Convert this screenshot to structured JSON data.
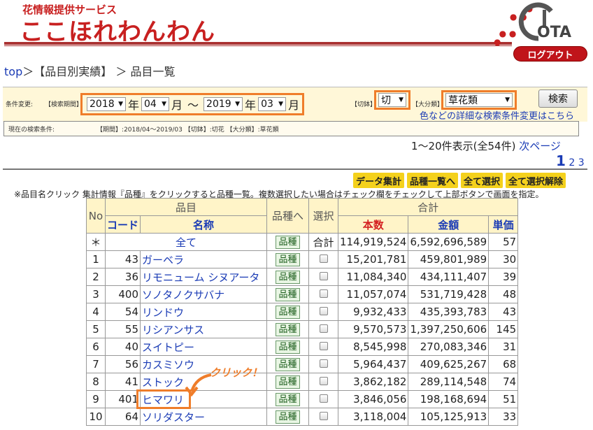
{
  "header": {
    "site_sub": "花情報提供サービス",
    "site_title": "ここほれわんわん",
    "logo_text": "OTA",
    "logout_label": "ログアウト"
  },
  "breadcrumb": {
    "top": "top",
    "sep1": "＞",
    "section": "【品目別実績】",
    "sep2": " ＞ ",
    "current": "品目一覧"
  },
  "conditions": {
    "label_change": "条件変更:",
    "label_period": "【検索期間】",
    "from_year": "2018",
    "from_month": "04",
    "to_year": "2019",
    "to_month": "03",
    "year_unit": "年",
    "month_unit": "月",
    "tilde": "〜",
    "label_kiri": "【切鉢】",
    "kiri_value": "切",
    "label_dai": "【大分類】",
    "dai_value": "草花類",
    "search_label": "検索",
    "detail_link": "色などの詳細な検索条件変更はこちら"
  },
  "current": {
    "label": "現在の検索条件:",
    "value": "【期間】:2018/04〜2019/03 【切鉢】:切花 【大分類】:草花類"
  },
  "pagination": {
    "range": "1〜20件表示(全54件)",
    "next": "次ページ",
    "current": "1",
    "p2": "2",
    "p3": "3"
  },
  "actions": [
    "データ集計",
    "品種一覧へ",
    "全て選択",
    "全て選択解除"
  ],
  "note": "※品目名クリック 集計情報『品種』をクリックすると品種一覧。複数選択したい場合はチェック欄をチェックして上部ボタンで画面を指定。",
  "table": {
    "h_no": "No",
    "h_item": "品目",
    "h_kind": "品種へ",
    "h_sel": "選択",
    "h_total": "合計",
    "h_code": "コード",
    "h_name": "名称",
    "h_num": "本数",
    "h_amt": "金額",
    "h_unit": "単価",
    "total_row": {
      "no": "＊",
      "name": "全て",
      "kind": "品種",
      "sel": "合計",
      "num": "114,919,524",
      "amt": "6,592,696,589",
      "unit": "57"
    },
    "kind_label": "品種",
    "rows": [
      {
        "no": "1",
        "code": "43",
        "name": "ガーベラ",
        "num": "15,201,781",
        "amt": "459,801,989",
        "unit": "30"
      },
      {
        "no": "2",
        "code": "36",
        "name": "リモニューム シヌアータ",
        "num": "11,084,340",
        "amt": "434,111,407",
        "unit": "39"
      },
      {
        "no": "3",
        "code": "400",
        "name": "ソノタノクサバナ",
        "num": "11,057,074",
        "amt": "531,719,428",
        "unit": "48"
      },
      {
        "no": "4",
        "code": "54",
        "name": "リンドウ",
        "num": "9,932,433",
        "amt": "435,393,783",
        "unit": "43"
      },
      {
        "no": "5",
        "code": "55",
        "name": "リシアンサス",
        "num": "9,570,573",
        "amt": "1,397,250,606",
        "unit": "145"
      },
      {
        "no": "6",
        "code": "40",
        "name": "スイトピー",
        "num": "8,545,998",
        "amt": "270,083,346",
        "unit": "31"
      },
      {
        "no": "7",
        "code": "56",
        "name": "カスミソウ",
        "num": "5,964,437",
        "amt": "409,625,267",
        "unit": "68"
      },
      {
        "no": "8",
        "code": "41",
        "name": "ストック",
        "num": "3,862,182",
        "amt": "289,114,548",
        "unit": "74"
      },
      {
        "no": "9",
        "code": "401",
        "name": "ヒマワリ",
        "num": "3,846,056",
        "amt": "198,168,694",
        "unit": "51"
      },
      {
        "no": "10",
        "code": "64",
        "name": "ソリダスター",
        "num": "3,118,004",
        "amt": "105,125,913",
        "unit": "33"
      }
    ]
  },
  "annotation": {
    "click": "クリック！"
  },
  "colors": {
    "brand_red": "#c82020",
    "highlight_orange": "#ef7d2a",
    "link_blue": "#1a3bb5",
    "action_yellow": "#f4d11c"
  }
}
